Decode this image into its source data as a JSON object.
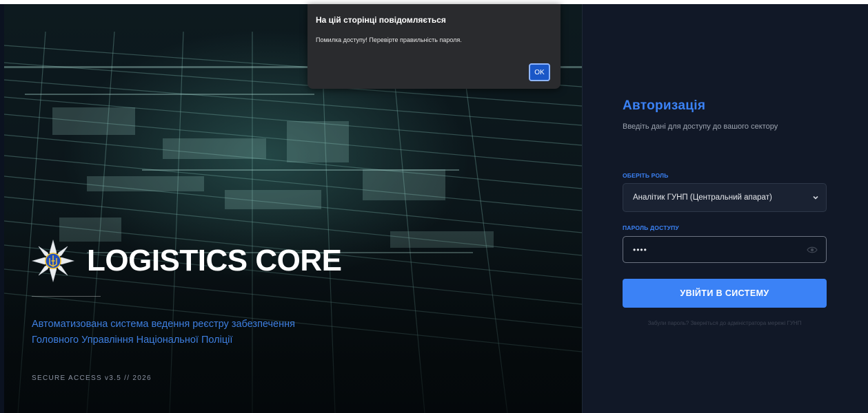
{
  "brand": {
    "name": "LOGISTICS CORE",
    "tagline_line1": "Автоматизована система ведення реєстру забезпечення",
    "tagline_line2": "Головного Управління Національної Поліції",
    "version": "SECURE ACCESS v3.5 // 2026"
  },
  "auth": {
    "title": "Авторизація",
    "subtitle": "Введіть дані для доступу до вашого сектору",
    "role_label": "ОБЕРІТЬ РОЛЬ",
    "role_value": "Аналітик ГУНП (Центральний апарат)",
    "password_label": "ПАРОЛЬ ДОСТУПУ",
    "password_value": "••••",
    "login_button": "УВІЙТИ В СИСТЕМУ",
    "forgot_text": "Забули пароль? Зверніться до адміністратора мережі ГУНП"
  },
  "dialog": {
    "title": "На цій сторінці повідомляється",
    "message": "Помилка доступу! Перевірте правильність пароля.",
    "ok_label": "OK"
  },
  "colors": {
    "accent": "#3b82f6",
    "panel_bg": "#111827",
    "dialog_bg": "#2a2b2e"
  },
  "icons": {
    "emblem": "police-emblem-icon",
    "select_caret": "chevron-down-icon",
    "password_toggle": "eye-icon"
  }
}
